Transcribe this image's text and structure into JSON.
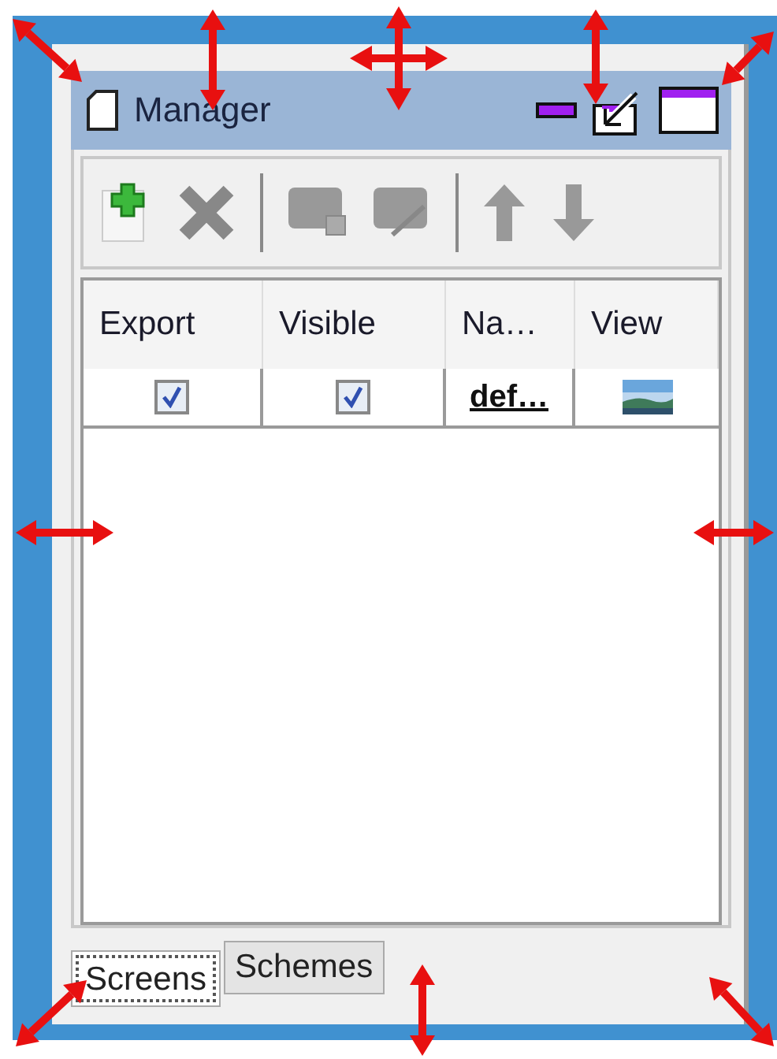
{
  "window": {
    "title": "Manager"
  },
  "table": {
    "columns": [
      "Export",
      "Visible",
      "Na…",
      "View"
    ],
    "rows": [
      {
        "export": true,
        "visible": true,
        "name": "def…"
      }
    ]
  },
  "tabs": [
    {
      "label": "Screens",
      "selected": true
    },
    {
      "label": "Schemes",
      "selected": false
    }
  ]
}
